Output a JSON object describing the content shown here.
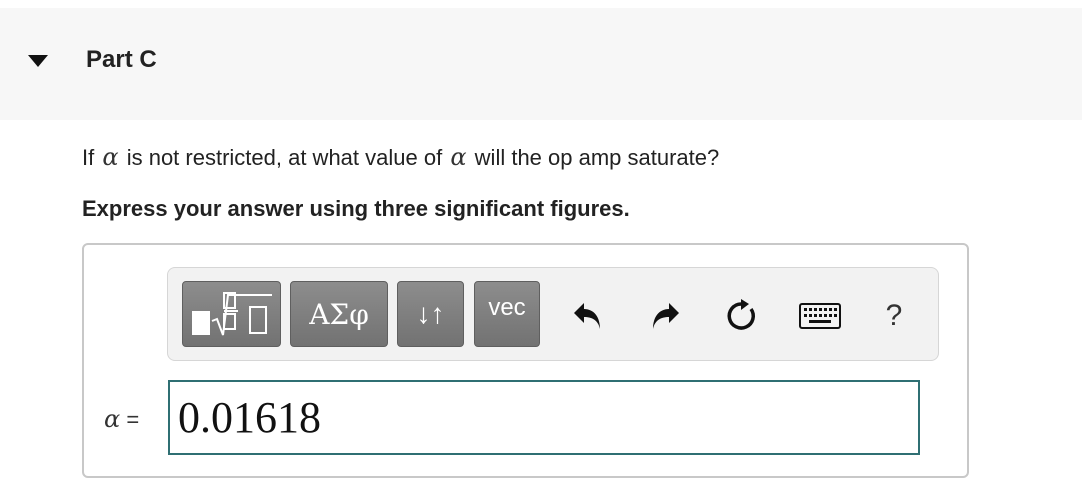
{
  "part": {
    "title": "Part C"
  },
  "question": {
    "prefix": "If",
    "symbol1": "α",
    "middle": "is not restricted, at what value of",
    "symbol2": "α",
    "suffix": "will the op amp saturate?"
  },
  "instruction": "Express your answer using three significant figures.",
  "toolbar": {
    "greek_label": "ΑΣφ",
    "arrows_label": "↓↑",
    "vec_label": "vec",
    "help_label": "?",
    "icons": [
      "templates-icon",
      "undo-icon",
      "redo-icon",
      "reset-icon",
      "keyboard-icon"
    ]
  },
  "answer": {
    "variable": "α",
    "equals": "=",
    "value": "0.01618"
  },
  "colors": {
    "header_bg": "#f7f7f7",
    "toolbar_button": "#7f7f7f",
    "input_border": "#2f6f73"
  }
}
